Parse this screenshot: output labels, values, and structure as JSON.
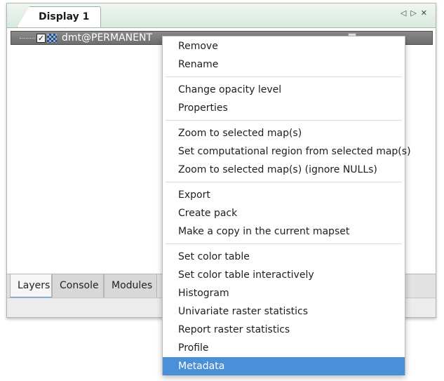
{
  "notebook": {
    "display_tab": "Display 1",
    "controls": {
      "prev": "◁",
      "next": "▷",
      "close": "✕"
    }
  },
  "layer": {
    "checked_glyph": "✓",
    "name": "dmt@PERMANENT",
    "icon": "raster-map-icon"
  },
  "bottom_tabs": [
    {
      "label": "Layers",
      "active": true
    },
    {
      "label": "Console",
      "active": false
    },
    {
      "label": "Modules",
      "active": false
    }
  ],
  "menu": {
    "groups": [
      [
        "Remove",
        "Rename"
      ],
      [
        "Change opacity level",
        "Properties"
      ],
      [
        "Zoom to selected map(s)",
        "Set computational region from selected map(s)",
        "Zoom to selected map(s) (ignore NULLs)"
      ],
      [
        "Export",
        "Create pack",
        "Make a copy in the current mapset"
      ],
      [
        "Set color table",
        "Set color table interactively",
        "Histogram",
        "Univariate raster statistics",
        "Report raster statistics",
        "Profile",
        "Metadata"
      ]
    ],
    "selected": "Metadata",
    "highlight_color": "#4a90d9"
  }
}
